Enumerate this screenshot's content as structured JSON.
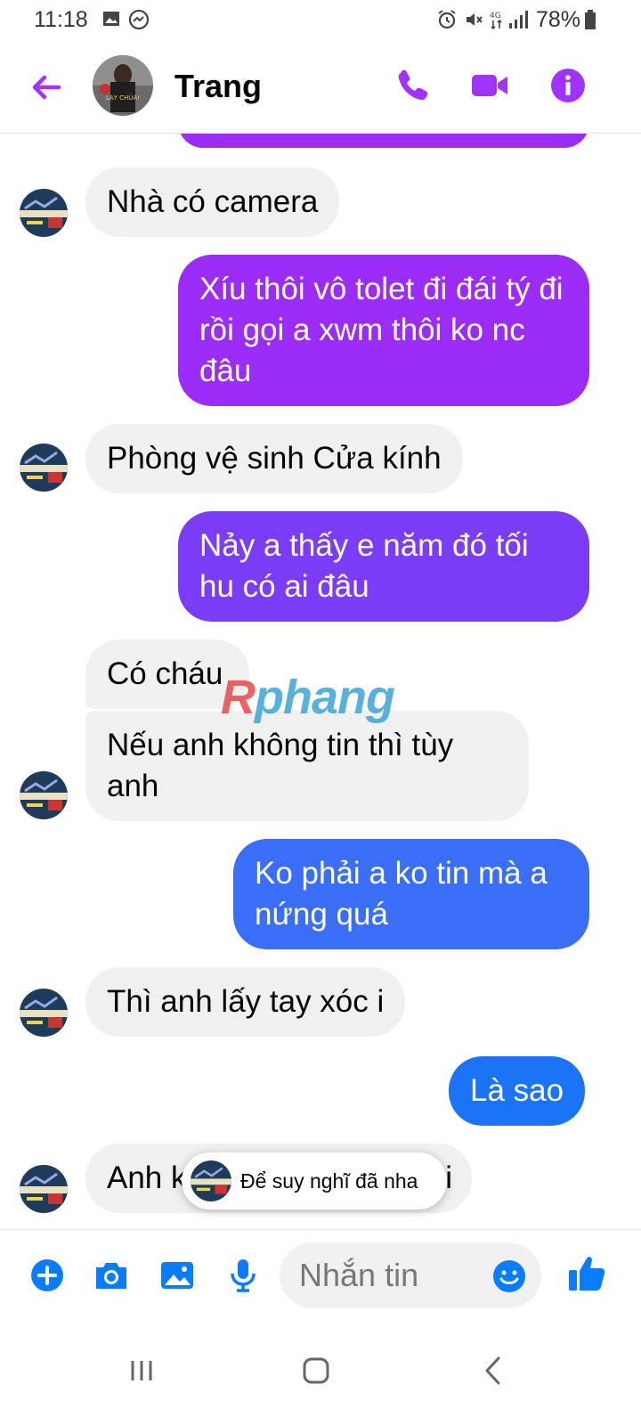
{
  "status_bar": {
    "time": "11:18",
    "battery_percent": "78%",
    "network": "4G"
  },
  "header": {
    "contact_name": "Trang",
    "avatar_caption": "LẠY CHÚA!"
  },
  "messages": [
    {
      "side": "received",
      "text": "Nhà có camera"
    },
    {
      "side": "sent",
      "text": "Xíu thôi vô tolet đi đái tý đi rồi gọi a xwm thôi ko nc đâu"
    },
    {
      "side": "received",
      "text": "Phòng vệ sinh Cửa kính"
    },
    {
      "side": "sent",
      "text": "Nảy a thấy e năm đó tối hu có ai đâu"
    },
    {
      "side": "received",
      "text": "Có cháu"
    },
    {
      "side": "received",
      "text": "Nếu anh không tin thì tùy anh"
    },
    {
      "side": "sent",
      "text": "Ko phải a ko tin mà a nứng quá"
    },
    {
      "side": "received",
      "text": "Thì anh lấy tay xóc i"
    },
    {
      "side": "sent",
      "text": "Là sao"
    },
    {
      "side": "received",
      "text_left": "Anh k",
      "text_right": "i"
    }
  ],
  "watermark": {
    "part1": "R",
    "part2": "phang"
  },
  "toast": {
    "text": "Để suy nghĩ đã nha"
  },
  "composer": {
    "placeholder": "Nhắn tin"
  },
  "icons": {
    "back": "arrow-left-icon",
    "call": "phone-icon",
    "video": "video-camera-icon",
    "info": "info-icon",
    "add": "plus-circle-icon",
    "camera": "camera-icon",
    "gallery": "image-icon",
    "mic": "microphone-icon",
    "emoji": "smiley-icon",
    "like": "thumbs-up-icon"
  },
  "colors": {
    "accent": "#a033ff",
    "sent_purple": "#9b2cf5",
    "sent_violet": "#7a3cf7",
    "sent_blue": "#3b6ef7",
    "sent_bright_blue": "#1b74f6",
    "composer_blue": "#0a7cff",
    "received_bg": "#f0f0f0"
  }
}
